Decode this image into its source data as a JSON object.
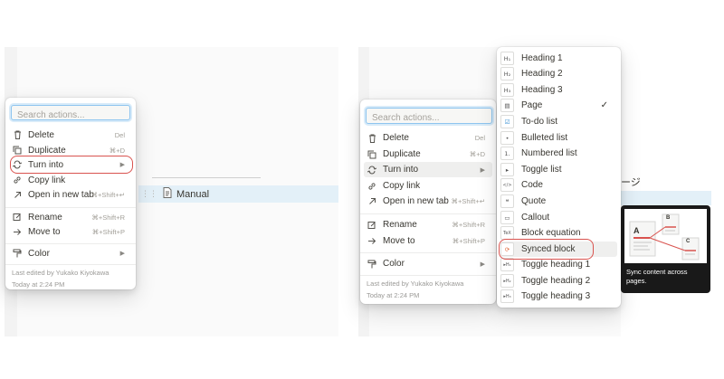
{
  "left": {
    "search": {
      "placeholder": "Search actions..."
    },
    "menu_items": [
      {
        "label": "Delete",
        "shortcut": "Del",
        "icon": "trash-icon"
      },
      {
        "label": "Duplicate",
        "shortcut": "⌘+D",
        "icon": "duplicate-icon"
      },
      {
        "label": "Turn into",
        "shortcut": "▶",
        "icon": "turn-into-icon"
      },
      {
        "label": "Copy link",
        "shortcut": "",
        "icon": "link-icon"
      },
      {
        "label": "Open in new tab",
        "shortcut": "⌘+Shift+↵",
        "icon": "arrow-up-right-icon"
      },
      {
        "label": "Rename",
        "shortcut": "⌘+Shift+R",
        "icon": "rename-icon"
      },
      {
        "label": "Move to",
        "shortcut": "⌘+Shift+P",
        "icon": "move-to-icon"
      },
      {
        "label": "Color",
        "shortcut": "▶",
        "icon": "paint-roller-icon"
      }
    ],
    "footer": {
      "edited_by": "Last edited by Yukako Kiyokawa",
      "time": "Today at 2:24 PM"
    },
    "page_row": {
      "title": "Manual",
      "icon": "page-icon"
    }
  },
  "right": {
    "search": {
      "placeholder": "Search actions..."
    },
    "menu_items": [
      {
        "label": "Delete",
        "shortcut": "Del",
        "icon": "trash-icon"
      },
      {
        "label": "Duplicate",
        "shortcut": "⌘+D",
        "icon": "duplicate-icon"
      },
      {
        "label": "Turn into",
        "shortcut": "▶",
        "icon": "turn-into-icon"
      },
      {
        "label": "Copy link",
        "shortcut": "",
        "icon": "link-icon"
      },
      {
        "label": "Open in new tab",
        "shortcut": "⌘+Shift+↵",
        "icon": "arrow-up-right-icon"
      },
      {
        "label": "Rename",
        "shortcut": "⌘+Shift+R",
        "icon": "rename-icon"
      },
      {
        "label": "Move to",
        "shortcut": "⌘+Shift+P",
        "icon": "move-to-icon"
      },
      {
        "label": "Color",
        "shortcut": "▶",
        "icon": "paint-roller-icon"
      }
    ],
    "footer": {
      "edited_by": "Last edited by Yukako Kiyokawa",
      "time": "Today at 2:24 PM"
    },
    "background_text": "ージ",
    "turn_into_submenu": [
      {
        "label": "Heading 1",
        "glyph": "H₁"
      },
      {
        "label": "Heading 2",
        "glyph": "H₂"
      },
      {
        "label": "Heading 3",
        "glyph": "H₃"
      },
      {
        "label": "Page",
        "glyph": "▤",
        "checked": "✓"
      },
      {
        "label": "To-do list",
        "glyph": "☑"
      },
      {
        "label": "Bulleted list",
        "glyph": "•"
      },
      {
        "label": "Numbered list",
        "glyph": "1."
      },
      {
        "label": "Toggle list",
        "glyph": "▸"
      },
      {
        "label": "Code",
        "glyph": "</>"
      },
      {
        "label": "Quote",
        "glyph": "❝"
      },
      {
        "label": "Callout",
        "glyph": "▭"
      },
      {
        "label": "Block equation",
        "glyph": "TeX"
      },
      {
        "label": "Synced block",
        "glyph": "⟳"
      },
      {
        "label": "Toggle heading 1",
        "glyph": "▸H₁"
      },
      {
        "label": "Toggle heading 2",
        "glyph": "▸H₂"
      },
      {
        "label": "Toggle heading 3",
        "glyph": "▸H₃"
      }
    ],
    "preview": {
      "caption": "Sync content across pages.",
      "labels": [
        "A",
        "B",
        "C"
      ]
    }
  },
  "colors": {
    "highlight_ring": "#d9534f",
    "search_focus": "#8ec5ef",
    "selected_row": "#e3f0f8",
    "preview_bg": "#191919"
  }
}
